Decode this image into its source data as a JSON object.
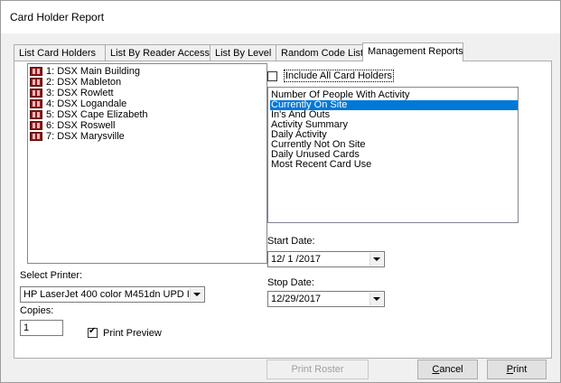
{
  "window": {
    "title": "Card Holder Report"
  },
  "tabs": [
    {
      "label": "List Card Holders"
    },
    {
      "label": "List By Reader Access"
    },
    {
      "label": "List By Level"
    },
    {
      "label": "Random Code List"
    },
    {
      "label": "Management Reports",
      "active": true
    }
  ],
  "readers": [
    "1:  DSX Main Building",
    "2:  DSX Mableton",
    "3:  DSX Rowlett",
    "4:  DSX Logandale",
    "5:  DSX Cape Elizabeth",
    "6:  DSX Roswell",
    "7:  DSX Marysville"
  ],
  "include_all": {
    "label": "Include All Card Holders",
    "checked": false
  },
  "reports": {
    "items": [
      "Number Of People With Activity",
      "Currently On Site",
      "In's And Outs",
      "Activity Summary",
      "Daily Activity",
      "Currently Not On Site",
      "Daily Unused Cards",
      "Most Recent Card Use"
    ],
    "selected": "Currently On Site"
  },
  "start_date": {
    "label": "Start Date:",
    "value": "12/ 1 /2017"
  },
  "stop_date": {
    "label": "Stop Date:",
    "value": "12/29/2017"
  },
  "printer": {
    "label": "Select Printer:",
    "value": "HP LaserJet 400 color M451dn UPD I"
  },
  "copies": {
    "label": "Copies:",
    "value": "1"
  },
  "print_preview": {
    "label": "Print Preview",
    "checked": true
  },
  "buttons": {
    "print_roster": "Print Roster",
    "cancel_first": "C",
    "cancel_rest": "ancel",
    "print_first": "P",
    "print_rest": "rint"
  },
  "colors": {
    "selection": "#0078d7",
    "reader_icon": "#8b1a1a"
  }
}
